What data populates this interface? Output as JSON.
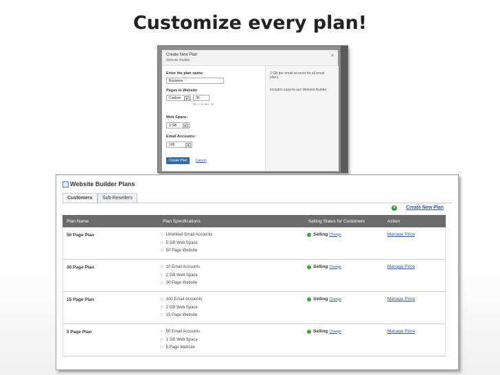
{
  "slide": {
    "title": "Customize every plan!"
  },
  "create_dialog": {
    "title": "Create New Plan",
    "subtitle": "Website Builder",
    "close_glyph": "×",
    "plan_name_label": "Enter the plan name:",
    "plan_name_value": "Business",
    "pages_label": "Pages in Website",
    "pages_select": "Custom",
    "pages_value": "30",
    "pages_hint": "Min: 2 & Max: 99",
    "web_space_label": "Web Space:",
    "web_space_value": "3 GB",
    "email_label": "Email Accounts:",
    "email_value": "100",
    "create_button": "Create Plan",
    "cancel_link": "Cancel",
    "tips": [
      "2 GB per email account for all email plans.",
      "Includes easy-to-use Website Builder"
    ]
  },
  "plans_panel": {
    "title": "Website Builder Plans",
    "tabs": [
      "Customers",
      "Sub-Resellers"
    ],
    "create_new": "Create New Plan",
    "columns": [
      "Plan Name",
      "Plan Specifications",
      "Selling Status for Customers",
      "Action"
    ],
    "rows": [
      {
        "name": "50 Page Plan",
        "specs": [
          "Unlimited Email Accounts",
          "5 GB Web Space",
          "50 Page Website"
        ],
        "status": "Selling",
        "change": "Change",
        "action": "Manage Price"
      },
      {
        "name": "30 Page Plan",
        "specs": [
          "10 Email Accounts",
          "2 GB Web Space",
          "30 Page Website"
        ],
        "status": "Selling",
        "change": "Change",
        "action": "Manage Price"
      },
      {
        "name": "15 Page Plan",
        "specs": [
          "100 Email Accounts",
          "2 GB Web Space",
          "15 Page Website"
        ],
        "status": "Selling",
        "change": "Change",
        "action": "Manage Price"
      },
      {
        "name": "5 Page Plan",
        "specs": [
          "50 Email Accounts",
          "1 GB Web Space",
          "5 Page Website"
        ],
        "status": "Selling",
        "change": "Change",
        "action": "Manage Price"
      }
    ]
  },
  "colors": {
    "header_bg": "#6b6b6b",
    "link": "#2a55a0",
    "selling_dot": "#3aa63a",
    "button": "#2f6aa9"
  },
  "icons": {
    "bullet": "◇",
    "plus": "+",
    "dropdown": "▼"
  }
}
